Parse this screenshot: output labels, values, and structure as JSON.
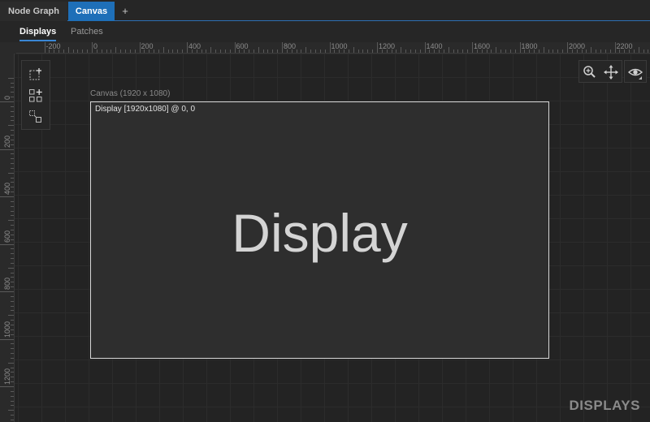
{
  "tabs": [
    {
      "label": "Node Graph"
    },
    {
      "label": "Canvas"
    },
    {
      "label": "+"
    }
  ],
  "subtabs": [
    {
      "label": "Displays",
      "active": true
    },
    {
      "label": "Patches"
    }
  ],
  "ruler": {
    "top_labels": [
      "-200",
      "0",
      "200",
      "400",
      "600",
      "800",
      "1000",
      "1200",
      "1400",
      "1600",
      "1800",
      "2000",
      "2200"
    ],
    "left_labels": [
      "0",
      "200",
      "400",
      "600",
      "800",
      "1000",
      "1200"
    ]
  },
  "toolbar": {
    "left_tools": [
      "add-display-icon",
      "add-group-icon",
      "select-area-icon"
    ],
    "right_tools": [
      "zoom-icon",
      "pan-icon",
      "eye-icon"
    ]
  },
  "canvas": {
    "caption": "Canvas (1920 x 1080)",
    "display_label": "Display [1920x1080] @ 0, 0",
    "display_text": "Display"
  },
  "watermark": "DISPLAYS",
  "colors": {
    "accent": "#1e6fb8",
    "background": "#1f1f1f",
    "display_fill": "#2e2e2e"
  }
}
